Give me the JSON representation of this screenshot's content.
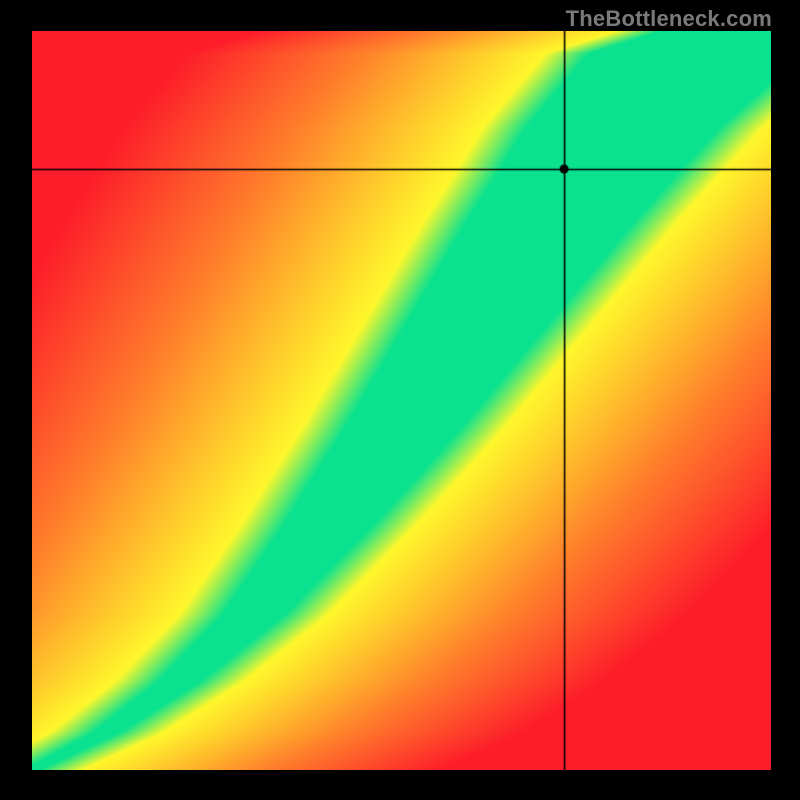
{
  "watermark": "TheBottleneck.com",
  "colors": {
    "background": "#000000",
    "heat_low": "#fd1c2a",
    "heat_mid_low": "#ff7e2b",
    "heat_mid": "#ffd02b",
    "heat_mid_high": "#fff72b",
    "heat_high": "#0ae28f",
    "crosshair": "#000000",
    "watermark": "#7a7a7a"
  },
  "chart_data": {
    "type": "heatmap",
    "title": "",
    "xlabel": "",
    "ylabel": "",
    "xlim": [
      0,
      1
    ],
    "ylim": [
      0,
      1
    ],
    "crosshair": {
      "x": 0.721,
      "y": 0.813
    },
    "ridge_keypoints": [
      {
        "x": 0.0,
        "y": 0.0
      },
      {
        "x": 0.1,
        "y": 0.05
      },
      {
        "x": 0.2,
        "y": 0.12
      },
      {
        "x": 0.3,
        "y": 0.21
      },
      {
        "x": 0.4,
        "y": 0.33
      },
      {
        "x": 0.5,
        "y": 0.46
      },
      {
        "x": 0.6,
        "y": 0.6
      },
      {
        "x": 0.7,
        "y": 0.74
      },
      {
        "x": 0.8,
        "y": 0.87
      },
      {
        "x": 0.9,
        "y": 0.97
      },
      {
        "x": 1.0,
        "y": 1.0
      }
    ],
    "ridge_width_fraction_at_y": [
      {
        "y": 0.0,
        "width": 0.01
      },
      {
        "y": 0.2,
        "width": 0.04
      },
      {
        "y": 0.4,
        "width": 0.07
      },
      {
        "y": 0.6,
        "width": 0.095
      },
      {
        "y": 0.8,
        "width": 0.12
      },
      {
        "y": 1.0,
        "width": 0.15
      }
    ],
    "description": "Square heatmap with a narrow green optimal band running along an S-curve from bottom-left to top-right. Band widens with height. Away from the band color transitions through yellow and orange to red. A black crosshair marks a point near the upper portion of the band."
  }
}
